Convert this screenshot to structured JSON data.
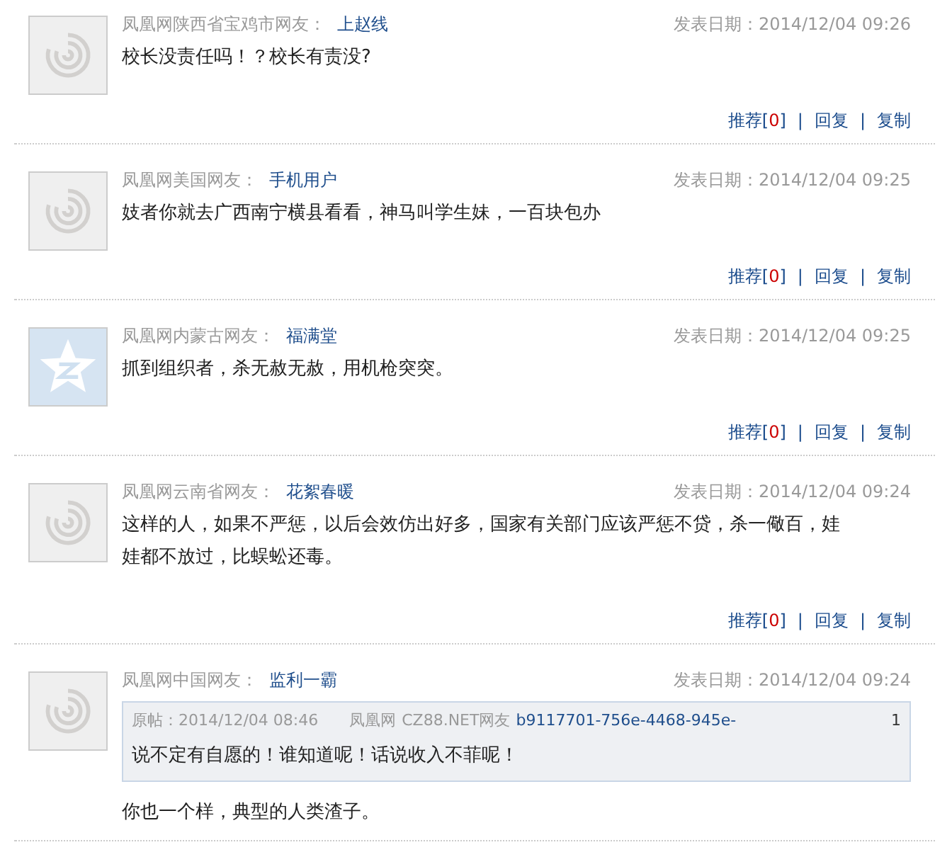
{
  "comments": [
    {
      "avatar": {
        "kind": "phoenix"
      },
      "location": "凤凰网陕西省宝鸡市网友：",
      "user": "上赵线",
      "posted": "发表日期：2014/12/04 09:26",
      "text": [
        "校长没责任吗！？校长有责没?"
      ],
      "actions": [
        {
          "kind": "recommend",
          "label": "推荐[",
          "count": "0",
          "suffix": "]"
        },
        {
          "kind": "separator",
          "label": "|"
        },
        {
          "kind": "link",
          "label": "回复"
        },
        {
          "kind": "separator",
          "label": "|"
        },
        {
          "kind": "link",
          "label": "复制"
        }
      ]
    },
    {
      "avatar": {
        "kind": "phoenix"
      },
      "location": "凤凰网美国网友：",
      "user": "手机用户",
      "posted": "发表日期：2014/12/04 09:25",
      "text": [
        "妓者你就去广西南宁横县看看，神马叫学生妹，一百块包办"
      ],
      "actions": [
        {
          "kind": "recommend",
          "label": "推荐[",
          "count": "0",
          "suffix": "]"
        },
        {
          "kind": "separator",
          "label": "|"
        },
        {
          "kind": "link",
          "label": "回复"
        },
        {
          "kind": "separator",
          "label": "|"
        },
        {
          "kind": "link",
          "label": "复制"
        }
      ]
    },
    {
      "avatar": {
        "kind": "star"
      },
      "location": "凤凰网内蒙古网友：",
      "user": "福满堂",
      "posted": "发表日期：2014/12/04 09:25",
      "text": [
        "抓到组织者，杀无赦无赦，用机枪突突。"
      ],
      "actions": [
        {
          "kind": "recommend",
          "label": "推荐[",
          "count": "0",
          "suffix": "]"
        },
        {
          "kind": "separator",
          "label": "|"
        },
        {
          "kind": "link",
          "label": "回复"
        },
        {
          "kind": "separator",
          "label": "|"
        },
        {
          "kind": "link",
          "label": "复制"
        }
      ]
    },
    {
      "avatar": {
        "kind": "phoenix"
      },
      "location": "凤凰网云南省网友：",
      "user": "花絮春暖",
      "posted": "发表日期：2014/12/04 09:24",
      "text": [
        "这样的人，如果不严惩，以后会效仿出好多，国家有关部门应该严惩不贷，杀一儆百，娃",
        "娃都不放过，比蜈蚣还毒。"
      ],
      "actions": [
        {
          "kind": "recommend",
          "label": "推荐[",
          "count": "0",
          "suffix": "]"
        },
        {
          "kind": "separator",
          "label": "|"
        },
        {
          "kind": "link",
          "label": "回复"
        },
        {
          "kind": "separator",
          "label": "|"
        },
        {
          "kind": "link",
          "label": "复制"
        }
      ]
    },
    {
      "avatar": {
        "kind": "phoenix"
      },
      "location": "凤凰网中国网友：",
      "user": "监利一霸",
      "posted": "发表日期：2014/12/04 09:24",
      "quote": {
        "label": "原帖：2014/12/04 08:46",
        "source": "凤凰网",
        "location": "CZ88.NET网友",
        "user": "b9117701-756e-4468-945e-",
        "floor": "1",
        "text": "说不定有自愿的！谁知道呢！话说收入不菲呢！"
      },
      "text": [
        "你也一个样，典型的人类渣子。"
      ]
    }
  ]
}
